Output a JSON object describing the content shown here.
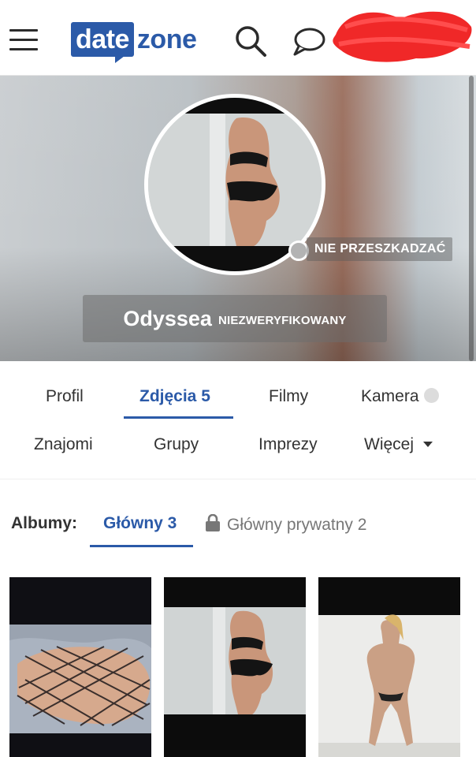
{
  "header": {
    "logo_left": "date",
    "logo_right": "zone",
    "icons": [
      "menu-icon",
      "search-icon",
      "chat-icon"
    ],
    "brand_color": "#2b5aa8"
  },
  "profile": {
    "status": "NIE PRZESZKADZAĆ",
    "name": "Odyssea",
    "verification": "NIEZWERYFIKOWANY"
  },
  "tabs": {
    "row1": [
      "Profil",
      "Zdjęcia 5",
      "Filmy",
      "Kamera"
    ],
    "row2": [
      "Znajomi",
      "Grupy",
      "Imprezy",
      "Więcej"
    ],
    "active": "Zdjęcia 5"
  },
  "albums": {
    "label": "Albumy:",
    "main": "Główny 3",
    "private": "Główny prywatny 2"
  }
}
